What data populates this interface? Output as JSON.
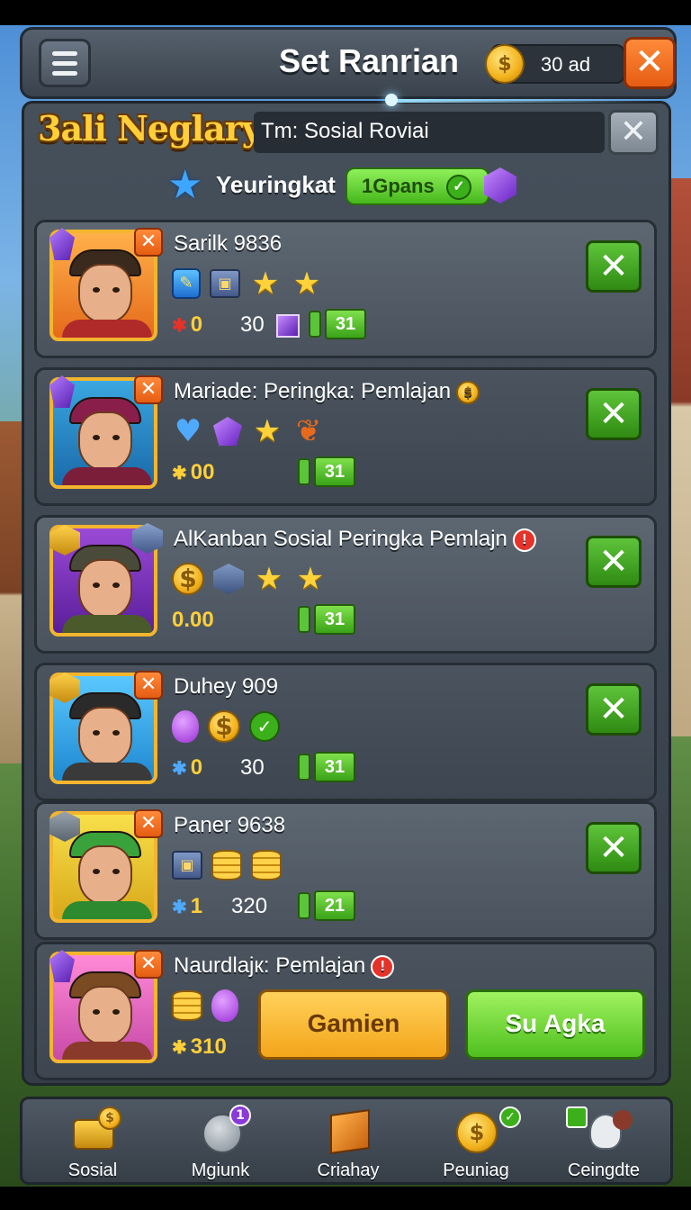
{
  "header": {
    "title": "Set Ranrian",
    "currency_value": "30 ad",
    "close_symbol": "✕"
  },
  "logo_text": "3ali Neglary",
  "search": {
    "value": "Tm: Sosial Roviai",
    "close_symbol": "✕"
  },
  "rank": {
    "label": "Yeuringkat",
    "pill": "1Gpans"
  },
  "players": [
    {
      "name": "Sarilk 9836",
      "stat_a": "0",
      "stat_a_icon": "✱",
      "stat_b": "30",
      "count": "31",
      "has_purple_sq": true,
      "theme": "orange"
    },
    {
      "name": "Mariade: Peringka: Pemlajan",
      "stat_a": "00",
      "stat_a_icon": "✱",
      "stat_b": "",
      "count": "31",
      "has_purple_sq": false,
      "theme": "maroon"
    },
    {
      "name": "AlKanban Sosial Peringka Pemlajn",
      "stat_a": "0.00",
      "stat_a_icon": "",
      "stat_b": "",
      "count": "31",
      "has_purple_sq": false,
      "theme": "purple"
    },
    {
      "name": "Duhey 909",
      "stat_a": "0",
      "stat_a_icon": "✱",
      "stat_b": "30",
      "count": "31",
      "has_purple_sq": false,
      "theme": "blue"
    },
    {
      "name": "Paner 9638",
      "stat_a": "1",
      "stat_a_icon": "✱",
      "stat_b": "320",
      "count": "21",
      "has_purple_sq": false,
      "theme": "yellow"
    },
    {
      "name": "Naurdlajк: Pemlajan",
      "stat_a": "310",
      "stat_a_icon": "✱",
      "stat_b": "",
      "count": "",
      "has_purple_sq": false,
      "theme": "pink"
    }
  ],
  "badges": {
    "alert": "!",
    "coin": "$"
  },
  "accept_symbol": "✕",
  "actions": {
    "orange_button": "Gamien",
    "green_button": "Su Agka"
  },
  "nav": [
    {
      "label": "Sosial",
      "badge": ""
    },
    {
      "label": "Mgiunk",
      "badge": "1"
    },
    {
      "label": "Criahay",
      "badge": ""
    },
    {
      "label": "Peuniag",
      "badge": ""
    },
    {
      "label": "Ceingdte",
      "badge": ""
    }
  ]
}
